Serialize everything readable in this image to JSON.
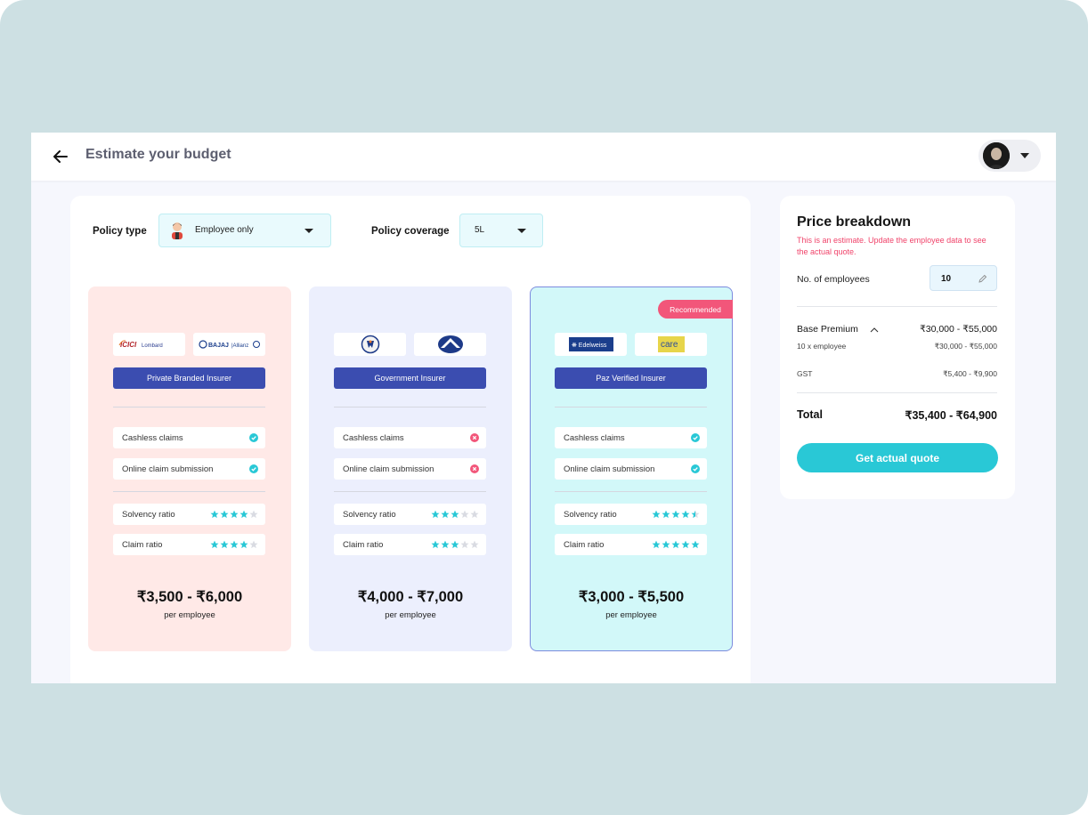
{
  "header": {
    "title": "Estimate your budget"
  },
  "filters": {
    "policy_type_label": "Policy type",
    "policy_type_value": "Employee only",
    "policy_coverage_label": "Policy coverage",
    "policy_coverage_value": "5L"
  },
  "plans": [
    {
      "logos": [
        "ICICI Lombard",
        "BAJAJ Allianz"
      ],
      "insurer_label": "Private Branded Insurer",
      "features": [
        {
          "label": "Cashless claims",
          "status": "check"
        },
        {
          "label": "Online claim submission",
          "status": "check"
        }
      ],
      "ratings": [
        {
          "label": "Solvency ratio",
          "stars": 4
        },
        {
          "label": "Claim ratio",
          "stars": 4
        }
      ],
      "price": "₹3,500 - ₹6,000",
      "price_unit": "per employee",
      "recommended": false
    },
    {
      "logos": [
        "government-insurer-logo-1",
        "government-insurer-logo-2"
      ],
      "insurer_label": "Government Insurer",
      "features": [
        {
          "label": "Cashless claims",
          "status": "cross"
        },
        {
          "label": "Online claim submission",
          "status": "cross"
        }
      ],
      "ratings": [
        {
          "label": "Solvency ratio",
          "stars": 3
        },
        {
          "label": "Claim ratio",
          "stars": 3
        }
      ],
      "price": "₹4,000 - ₹7,000",
      "price_unit": "per employee",
      "recommended": false
    },
    {
      "logos": [
        "Edelweiss",
        "care"
      ],
      "insurer_label": "Paz Verified Insurer",
      "features": [
        {
          "label": "Cashless claims",
          "status": "check"
        },
        {
          "label": "Online claim submission",
          "status": "check"
        }
      ],
      "ratings": [
        {
          "label": "Solvency ratio",
          "stars": 4.5
        },
        {
          "label": "Claim ratio",
          "stars": 5
        }
      ],
      "price": "₹3,000 - ₹5,500",
      "price_unit": "per employee",
      "recommended": true,
      "badge": "Recommended"
    }
  ],
  "breakdown": {
    "title": "Price breakdown",
    "note": "This is an estimate. Update the employee data to see the actual quote.",
    "employees_label": "No. of  employees",
    "employees_value": "10",
    "base_premium_label": "Base Premium",
    "base_premium_value": "₹30,000 - ₹55,000",
    "base_sub_label": "10 x employee",
    "base_sub_value": "₹30,000 - ₹55,000",
    "gst_label": "GST",
    "gst_value": "₹5,400 - ₹9,900",
    "total_label": "Total",
    "total_value": "₹35,400 - ₹64,900",
    "cta": "Get actual quote"
  },
  "colors": {
    "accent": "#29c8d6",
    "insurer_button": "#3b4db0",
    "check": "#29c8d6",
    "cross": "#f2567a",
    "star_on": "#29c8d6",
    "star_off": "#d9dbe2"
  }
}
